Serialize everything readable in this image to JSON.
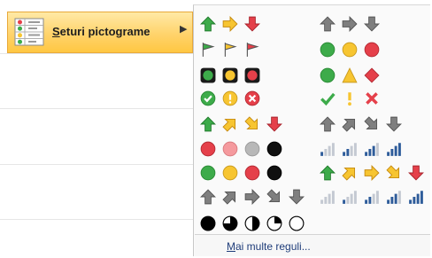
{
  "menu": {
    "label_hotkey": "S",
    "label_rest": "eturi pictograme",
    "icon": "icon-sets-icon",
    "submenu_arrow": "chevron-right-icon"
  },
  "icon_sets": [
    {
      "name": "3-arrows-colored",
      "icons": [
        "arrow-up-green",
        "arrow-right-yellow",
        "arrow-down-red"
      ]
    },
    {
      "name": "3-arrows-gray",
      "icons": [
        "arrow-up-gray",
        "arrow-right-gray",
        "arrow-down-gray"
      ]
    },
    {
      "name": "3-flags",
      "icons": [
        "flag-green",
        "flag-yellow",
        "flag-red"
      ]
    },
    {
      "name": "3-traffic-lights-unrimmed",
      "icons": [
        "circle-green",
        "circle-yellow",
        "circle-red"
      ]
    },
    {
      "name": "3-traffic-lights-rimmed",
      "icons": [
        "rimmed-light-green",
        "rimmed-light-yellow",
        "rimmed-light-red"
      ]
    },
    {
      "name": "3-signs",
      "icons": [
        "circle-green",
        "triangle-yellow",
        "diamond-red"
      ]
    },
    {
      "name": "3-symbols-circled",
      "icons": [
        "circled-check",
        "circled-exclamation",
        "circled-x"
      ]
    },
    {
      "name": "3-symbols-uncircled",
      "icons": [
        "check",
        "exclamation",
        "x"
      ]
    },
    {
      "name": "4-arrows-colored",
      "icons": [
        "arrow-up-green",
        "arrow-up-right-yellow",
        "arrow-down-right-yellow",
        "arrow-down-red"
      ]
    },
    {
      "name": "4-arrows-gray",
      "icons": [
        "arrow-up-gray",
        "arrow-up-right-gray",
        "arrow-down-right-gray",
        "arrow-down-gray"
      ]
    },
    {
      "name": "red-to-black",
      "icons": [
        "circle-red",
        "circle-pink",
        "circle-gray",
        "circle-black"
      ]
    },
    {
      "name": "4-ratings",
      "icons": [
        "bars-1",
        "bars-2",
        "bars-3",
        "bars-4"
      ]
    },
    {
      "name": "4-traffic-lights",
      "icons": [
        "circle-green",
        "circle-yellow",
        "circle-red",
        "circle-black"
      ]
    },
    {
      "name": "5-arrows-colored",
      "icons": [
        "arrow-up-green",
        "arrow-up-right-yellow",
        "arrow-right-yellow",
        "arrow-down-right-yellow",
        "arrow-down-red"
      ]
    },
    {
      "name": "5-arrows-gray",
      "icons": [
        "arrow-up-gray",
        "arrow-up-right-gray",
        "arrow-right-gray",
        "arrow-down-right-gray",
        "arrow-down-gray"
      ]
    },
    {
      "name": "5-ratings",
      "icons": [
        "bars-0",
        "bars-1",
        "bars-2",
        "bars-3",
        "bars-4"
      ]
    },
    {
      "name": "5-quarters",
      "icons": [
        "quarter-4",
        "quarter-3",
        "quarter-2",
        "quarter-1",
        "quarter-0"
      ]
    }
  ],
  "footer": {
    "link_hotkey": "M",
    "link_rest": "ai multe reguli..."
  },
  "colors": {
    "highlight_top": "#ffe9a6",
    "highlight_bottom": "#ffc742",
    "green": "#3dab4a",
    "yellow": "#f7c531",
    "red": "#e5404a",
    "gray": "#7f7f7f",
    "blue": "#2e5c9a"
  }
}
